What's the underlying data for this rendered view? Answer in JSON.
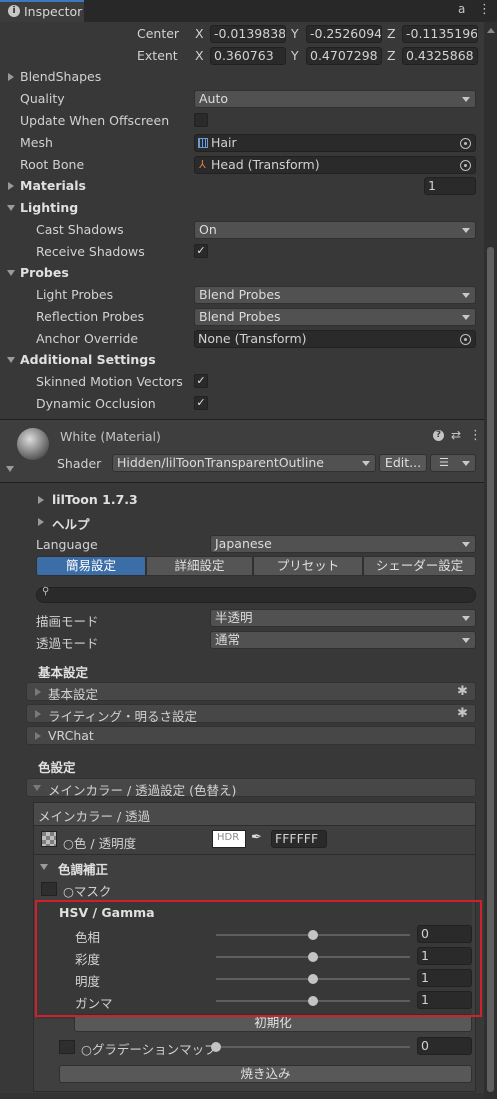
{
  "tab": {
    "title": "Inspector"
  },
  "bounds": {
    "center_label": "Center",
    "extent_label": "Extent",
    "x": "X",
    "y": "Y",
    "z": "Z",
    "center": [
      "-0.0139838",
      "-0.2526094",
      "-0.1135196"
    ],
    "extent": [
      "0.360763",
      "0.4707298",
      "0.4325868"
    ]
  },
  "renderer": {
    "blendshapes": "BlendShapes",
    "quality_label": "Quality",
    "quality_value": "Auto",
    "update_offscreen_label": "Update When Offscreen",
    "mesh_label": "Mesh",
    "mesh_value": "Hair",
    "root_bone_label": "Root Bone",
    "root_bone_value": "Head (Transform)",
    "materials_label": "Materials",
    "materials_count": "1",
    "lighting_label": "Lighting",
    "cast_shadows_label": "Cast Shadows",
    "cast_shadows_value": "On",
    "receive_shadows_label": "Receive Shadows",
    "probes_label": "Probes",
    "light_probes_label": "Light Probes",
    "light_probes_value": "Blend Probes",
    "reflection_probes_label": "Reflection Probes",
    "reflection_probes_value": "Blend Probes",
    "anchor_override_label": "Anchor Override",
    "anchor_override_value": "None (Transform)",
    "additional_label": "Additional Settings",
    "skinned_motion_label": "Skinned Motion Vectors",
    "dynamic_occlusion_label": "Dynamic Occlusion",
    "checkmark": "✓"
  },
  "material": {
    "title": "White (Material)",
    "shader_label": "Shader",
    "shader_value": "Hidden/lilToonTransparentOutline",
    "edit_label": "Edit..."
  },
  "liltoon": {
    "version": "lilToon 1.7.3",
    "help": "ヘルプ",
    "language_label": "Language",
    "language_value": "Japanese",
    "tabs": [
      "簡易設定",
      "詳細設定",
      "プリセット",
      "シェーダー設定"
    ],
    "render_mode_label": "描画モード",
    "render_mode_value": "半透明",
    "transparent_mode_label": "透過モード",
    "transparent_mode_value": "通常",
    "basic_header": "基本設定",
    "fold_basic": "基本設定",
    "fold_lighting": "ライティング・明るさ設定",
    "fold_vrchat": "VRChat",
    "color_header": "色設定",
    "main_color_fold": "メインカラー / 透過設定 (色替え)",
    "main_color_sub": "メインカラー / 透過",
    "color_alpha_label": "○色 / 透明度",
    "hdr": "HDR",
    "color_hex": "FFFFFF",
    "correction_label": "色調補正",
    "mask_label": "○マスク",
    "hsv_title": "HSV / Gamma",
    "hsv": [
      {
        "label": "色相",
        "value": "0",
        "fraction": 0.5
      },
      {
        "label": "彩度",
        "value": "1",
        "fraction": 0.5
      },
      {
        "label": "明度",
        "value": "1",
        "fraction": 0.5
      },
      {
        "label": "ガンマ",
        "value": "1",
        "fraction": 0.5
      }
    ],
    "reset_label": "初期化",
    "gradation_label": "○グラデーションマップ",
    "gradation_value": "0",
    "gradation_fraction": 0.0,
    "bake_label": "焼き込み"
  },
  "colors": {
    "highlight": "#d0202a",
    "tab_active": "#3b6ea7"
  }
}
